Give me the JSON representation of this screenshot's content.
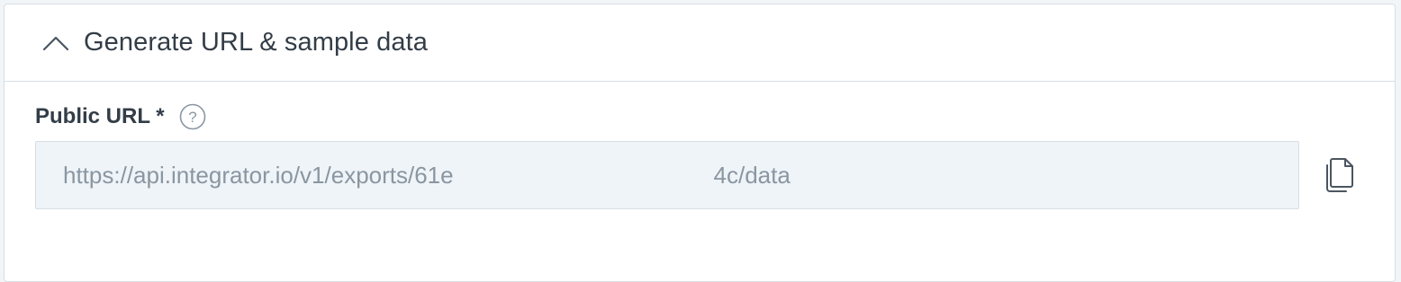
{
  "section": {
    "title": "Generate URL & sample data",
    "chevron_icon": "chevron-up-icon"
  },
  "public_url": {
    "label": "Public URL *",
    "help_icon": "help-circle-icon",
    "value": "https://api.integrator.io/v1/exports/61e                                        4c/data",
    "copy_icon": "copy-icon"
  },
  "colors": {
    "text": "#333d47",
    "muted": "#8a96a1",
    "border": "#d6dee5",
    "input_bg": "#eff4f8"
  }
}
